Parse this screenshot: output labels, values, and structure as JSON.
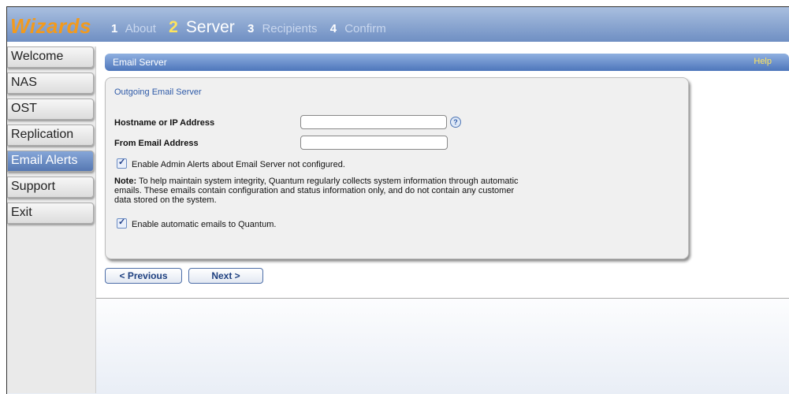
{
  "app": {
    "logo": "Wizards"
  },
  "steps": [
    {
      "num": "1",
      "label": "About"
    },
    {
      "num": "2",
      "label": "Server"
    },
    {
      "num": "3",
      "label": "Recipients"
    },
    {
      "num": "4",
      "label": "Confirm"
    }
  ],
  "sidebar": {
    "items": [
      {
        "label": "Welcome"
      },
      {
        "label": "NAS"
      },
      {
        "label": "OST"
      },
      {
        "label": "Replication"
      },
      {
        "label": "Email Alerts"
      },
      {
        "label": "Support"
      },
      {
        "label": "Exit"
      }
    ]
  },
  "page": {
    "title": "Email Server",
    "help": "Help"
  },
  "form": {
    "section_title": "Outgoing Email Server",
    "hostname_label": "Hostname or IP Address",
    "hostname_value": "",
    "from_label": "From Email Address",
    "from_value": "",
    "help_icon_glyph": "?",
    "admin_alerts_label": "Enable Admin Alerts about Email Server not configured.",
    "note_prefix": "Note:",
    "note_line1": " To help maintain system integrity, Quantum regularly collects system information through automatic",
    "note_line2": "emails. These emails contain configuration and status information only, and do not contain any customer",
    "note_line3": "data stored on the system.",
    "auto_emails_label": "Enable automatic emails to Quantum."
  },
  "buttons": {
    "previous": "< Previous",
    "next": "Next >"
  },
  "colors": {
    "accent": "#4d76bb",
    "logo": "#f29a1d",
    "help": "#ffe45c"
  }
}
